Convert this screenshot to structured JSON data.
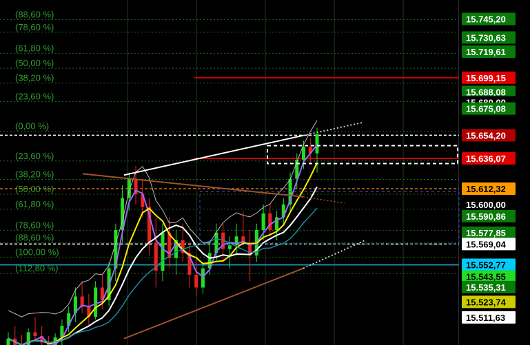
{
  "chart_data": {
    "type": "candlestick",
    "title": "",
    "fib_levels": [
      {
        "label": "(88,60 %)",
        "price": 15744.7
      },
      {
        "label": "(78,60 %)",
        "price": 15734.8
      },
      {
        "label": "(61,80 %)",
        "price": 15718.3
      },
      {
        "label": "(50,00 %)",
        "price": 15706.6
      },
      {
        "label": "(38,20 %)",
        "price": 15695.0
      },
      {
        "label": "(23,60 %)",
        "price": 15680.6
      },
      {
        "label": "(0,00 %)",
        "price": 15657.3
      },
      {
        "label": "(23,60 %)",
        "price": 15634.0
      },
      {
        "label": "(38,20 %)",
        "price": 15619.6
      },
      {
        "label": "(50,00 %)",
        "price": 15608.0
      },
      {
        "label": "(61,80 %)",
        "price": 15596.3
      },
      {
        "label": "(78,60 %)",
        "price": 15579.8
      },
      {
        "label": "(88,60 %)",
        "price": 15569.9
      },
      {
        "label": "(100,00 %)",
        "price": 15558.6
      },
      {
        "label": "(112,80 %)",
        "price": 15546.0
      }
    ],
    "price_badges": [
      {
        "text": "15.745,20",
        "price": 15745.2,
        "bg": "#0a7a0a",
        "fg": "#ffffff"
      },
      {
        "text": "15.730,63",
        "price": 15730.63,
        "bg": "#0a7a0a",
        "fg": "#ffffff"
      },
      {
        "text": "15.719,61",
        "price": 15719.61,
        "bg": "#0a7a0a",
        "fg": "#ffffff"
      },
      {
        "text": "15.699,15",
        "price": 15699.15,
        "bg": "#e00000",
        "fg": "#ffffff"
      },
      {
        "text": "15.688,08",
        "price": 15688.08,
        "bg": "#0a7a0a",
        "fg": "#ffffff"
      },
      {
        "text": "15.680,00",
        "price": 15680.0,
        "bg": "#000000",
        "fg": "#ffffff"
      },
      {
        "text": "15.675,08",
        "price": 15675.08,
        "bg": "#0a7a0a",
        "fg": "#ffffff"
      },
      {
        "text": "15.654,20",
        "price": 15654.2,
        "bg": "#b00000",
        "fg": "#ffffff"
      },
      {
        "text": "15.636,07",
        "price": 15636.07,
        "bg": "#e00000",
        "fg": "#ffffff"
      },
      {
        "text": "15.612,32",
        "price": 15612.32,
        "bg": "#ff9900",
        "fg": "#000000"
      },
      {
        "text": "15.600,00",
        "price": 15600.0,
        "bg": "#000000",
        "fg": "#ffffff"
      },
      {
        "text": "15.590,86",
        "price": 15590.86,
        "bg": "#0a7a0a",
        "fg": "#ffffff"
      },
      {
        "text": "15.577,85",
        "price": 15577.85,
        "bg": "#0a7a0a",
        "fg": "#ffffff"
      },
      {
        "text": "15.569,04",
        "price": 15569.04,
        "bg": "#ffffff",
        "fg": "#000000"
      },
      {
        "text": "15.552,77",
        "price": 15552.77,
        "bg": "#00ccff",
        "fg": "#000000"
      },
      {
        "text": "15.543,55",
        "price": 15543.55,
        "bg": "#22dd22",
        "fg": "#000000"
      },
      {
        "text": "15.535,31",
        "price": 15535.31,
        "bg": "#0a7a0a",
        "fg": "#ffffff"
      },
      {
        "text": "15.523,74",
        "price": 15523.74,
        "bg": "#cccc00",
        "fg": "#000000"
      },
      {
        "text": "15.511,63",
        "price": 15511.63,
        "bg": "#ffffff",
        "fg": "#000000"
      }
    ],
    "price_lines": [
      {
        "price": 15699.15,
        "color": "#cc0000",
        "style": "solid",
        "from": "mid"
      },
      {
        "price": 15654.2,
        "color": "#ffffff",
        "style": "dashed",
        "from": "left"
      },
      {
        "price": 15636.07,
        "color": "#cc0000",
        "style": "solid",
        "from": "mid"
      },
      {
        "price": 15612.32,
        "color": "#d07000",
        "style": "dashed",
        "from": "left"
      },
      {
        "price": 15569.04,
        "color": "#ffffff",
        "style": "dashed",
        "from": "left"
      },
      {
        "price": 15552.77,
        "color": "#1a8aa0",
        "style": "solid",
        "from": "left"
      }
    ],
    "candles": [
      {
        "o": 15488,
        "h": 15500,
        "l": 15482,
        "c": 15495
      },
      {
        "o": 15495,
        "h": 15505,
        "l": 15488,
        "c": 15490
      },
      {
        "o": 15490,
        "h": 15498,
        "l": 15480,
        "c": 15485
      },
      {
        "o": 15485,
        "h": 15503,
        "l": 15484,
        "c": 15500
      },
      {
        "o": 15500,
        "h": 15512,
        "l": 15494,
        "c": 15497
      },
      {
        "o": 15497,
        "h": 15505,
        "l": 15488,
        "c": 15492
      },
      {
        "o": 15492,
        "h": 15497,
        "l": 15478,
        "c": 15484
      },
      {
        "o": 15484,
        "h": 15499,
        "l": 15482,
        "c": 15496
      },
      {
        "o": 15496,
        "h": 15510,
        "l": 15490,
        "c": 15505
      },
      {
        "o": 15505,
        "h": 15520,
        "l": 15500,
        "c": 15515
      },
      {
        "o": 15515,
        "h": 15535,
        "l": 15508,
        "c": 15528
      },
      {
        "o": 15528,
        "h": 15540,
        "l": 15515,
        "c": 15520
      },
      {
        "o": 15520,
        "h": 15530,
        "l": 15505,
        "c": 15512
      },
      {
        "o": 15512,
        "h": 15540,
        "l": 15510,
        "c": 15535
      },
      {
        "o": 15535,
        "h": 15545,
        "l": 15518,
        "c": 15525
      },
      {
        "o": 15525,
        "h": 15555,
        "l": 15520,
        "c": 15550
      },
      {
        "o": 15550,
        "h": 15585,
        "l": 15540,
        "c": 15580
      },
      {
        "o": 15580,
        "h": 15615,
        "l": 15570,
        "c": 15605
      },
      {
        "o": 15605,
        "h": 15625,
        "l": 15595,
        "c": 15620
      },
      {
        "o": 15620,
        "h": 15630,
        "l": 15600,
        "c": 15608
      },
      {
        "o": 15608,
        "h": 15620,
        "l": 15590,
        "c": 15598
      },
      {
        "o": 15598,
        "h": 15605,
        "l": 15560,
        "c": 15570
      },
      {
        "o": 15570,
        "h": 15590,
        "l": 15535,
        "c": 15548
      },
      {
        "o": 15548,
        "h": 15585,
        "l": 15540,
        "c": 15578
      },
      {
        "o": 15578,
        "h": 15590,
        "l": 15550,
        "c": 15558
      },
      {
        "o": 15558,
        "h": 15580,
        "l": 15545,
        "c": 15572
      },
      {
        "o": 15572,
        "h": 15585,
        "l": 15555,
        "c": 15562
      },
      {
        "o": 15562,
        "h": 15570,
        "l": 15535,
        "c": 15545
      },
      {
        "o": 15545,
        "h": 15560,
        "l": 15528,
        "c": 15535
      },
      {
        "o": 15535,
        "h": 15555,
        "l": 15530,
        "c": 15550
      },
      {
        "o": 15550,
        "h": 15570,
        "l": 15545,
        "c": 15562
      },
      {
        "o": 15562,
        "h": 15585,
        "l": 15555,
        "c": 15578
      },
      {
        "o": 15578,
        "h": 15585,
        "l": 15555,
        "c": 15565
      },
      {
        "o": 15565,
        "h": 15575,
        "l": 15550,
        "c": 15568
      },
      {
        "o": 15568,
        "h": 15585,
        "l": 15560,
        "c": 15575
      },
      {
        "o": 15575,
        "h": 15595,
        "l": 15568,
        "c": 15570
      },
      {
        "o": 15570,
        "h": 15580,
        "l": 15540,
        "c": 15560
      },
      {
        "o": 15560,
        "h": 15585,
        "l": 15555,
        "c": 15580
      },
      {
        "o": 15580,
        "h": 15600,
        "l": 15572,
        "c": 15593
      },
      {
        "o": 15593,
        "h": 15600,
        "l": 15575,
        "c": 15580
      },
      {
        "o": 15580,
        "h": 15595,
        "l": 15572,
        "c": 15590
      },
      {
        "o": 15590,
        "h": 15605,
        "l": 15585,
        "c": 15600
      },
      {
        "o": 15600,
        "h": 15625,
        "l": 15595,
        "c": 15620
      },
      {
        "o": 15620,
        "h": 15640,
        "l": 15612,
        "c": 15635
      },
      {
        "o": 15635,
        "h": 15650,
        "l": 15628,
        "c": 15645
      },
      {
        "o": 15645,
        "h": 15652,
        "l": 15632,
        "c": 15640
      },
      {
        "o": 15640,
        "h": 15660,
        "l": 15625,
        "c": 15655
      }
    ],
    "price_range": [
      15490,
      15760
    ]
  }
}
